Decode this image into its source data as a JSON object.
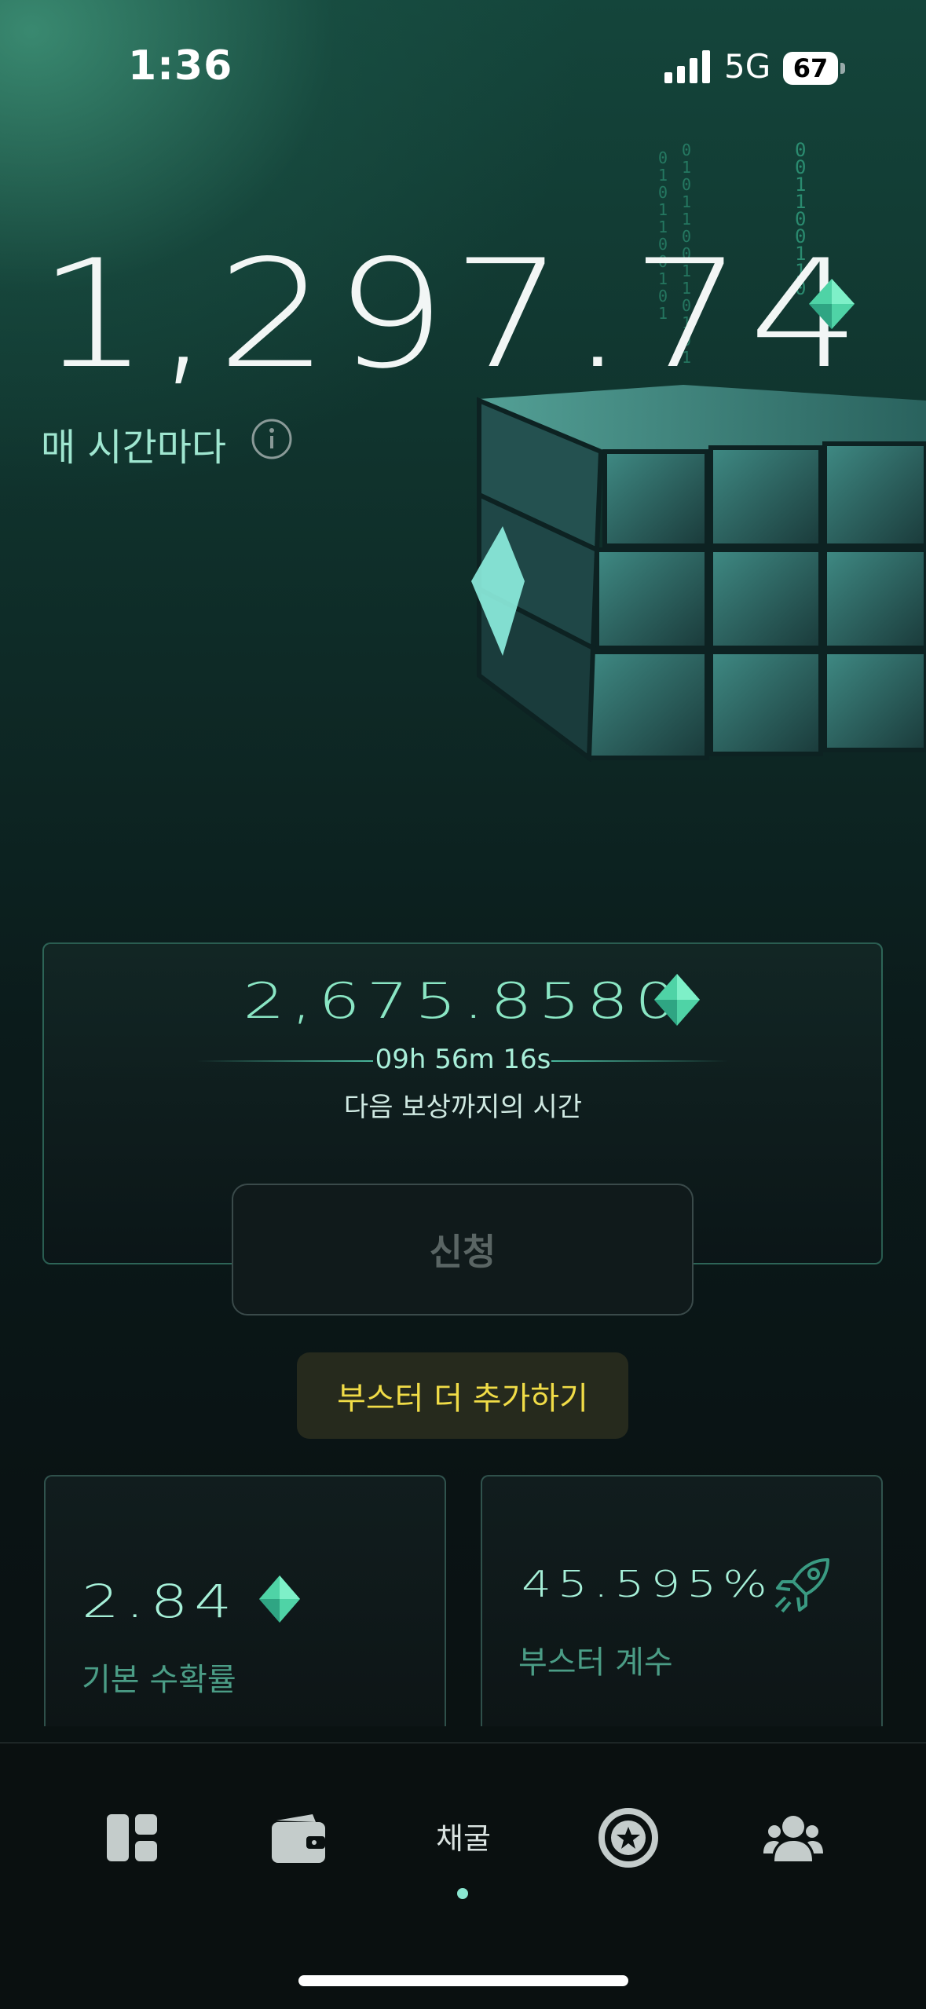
{
  "status_bar": {
    "time": "1:36",
    "network": "5G",
    "battery": "67"
  },
  "balance": {
    "amount": "1,297.74",
    "gem_icon": "diamond-gem-icon",
    "rate_label": "매 시간마다",
    "info_icon": "info-icon"
  },
  "reward": {
    "amount": "2,675.8580",
    "countdown": "09h 56m 16s",
    "caption": "다음 보상까지의 시간",
    "apply_label": "신청"
  },
  "booster_button": "부스터 더 추가하기",
  "stats": {
    "base_rate_value": "2.84",
    "base_rate_label": "기본 수확률",
    "booster_value": "45.595%",
    "booster_label": "부스터 계수",
    "booster_icon": "rocket-icon"
  },
  "nav": {
    "items": [
      {
        "name": "dashboard",
        "icon": "dashboard-icon"
      },
      {
        "name": "wallet",
        "icon": "wallet-icon"
      },
      {
        "name": "mining",
        "label": "채굴",
        "active": true
      },
      {
        "name": "rank",
        "icon": "star-badge-icon"
      },
      {
        "name": "friends",
        "icon": "people-icon"
      }
    ]
  },
  "colors": {
    "accent": "#8ae6c4",
    "booster_text": "#f0dc47",
    "background": "#0a1214"
  }
}
